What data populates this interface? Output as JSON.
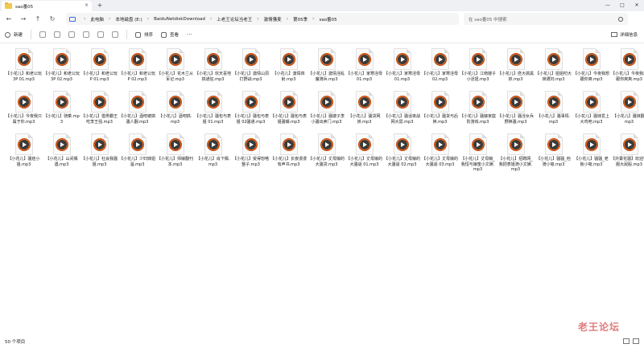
{
  "window": {
    "tab_title": "sao番05",
    "tab_close": "×",
    "new_tab": "+",
    "controls": [
      "—",
      "□",
      "✕"
    ]
  },
  "nav": {
    "back": "←",
    "forward": "→",
    "up": "↑",
    "refresh": "↻"
  },
  "breadcrumbs": [
    "此电脑",
    "本地磁盘 (E:)",
    "BaiduNetdiskDownload",
    "上老王论坛当老王",
    "激情骚麦",
    "第05季",
    "sao番05"
  ],
  "breadcrumb_sep": "›",
  "search": {
    "placeholder": "在 sao番05 中搜索"
  },
  "toolbar": {
    "new_label": "新建",
    "sort_label": "排序",
    "view_label": "查看",
    "more": "···",
    "details_label": "详细信息"
  },
  "files": [
    "【小花儿】和老公玩3P 01.mp3",
    "【小花儿】和老公玩3P 02.mp3",
    "【小花儿】和老公玩P 01.mp3",
    "【小花儿】和老公玩P 02.mp3",
    "【小花儿】花木兰从军记.mp3",
    "【小花儿】欢天喜地搞通狂.mp3",
    "【小花儿】激情山洞打野战.mp3",
    "【小花儿】激情四射.mp3",
    "【小花儿】激情淫乱魔骑兵.mp3",
    "【小花儿】家寒淫母 01.mp3",
    "【小花儿】家寒淫母 01.mp3",
    "【小花儿】家寒淫母 02.mp3",
    "【小花儿】江南嫂子小淫妞.mp3",
    "【小花儿】痉大搞黑妖.mp3",
    "【小花儿】姐姐叨大妹遭妇.mp3",
    "【小花儿】今夜我想跟你爽.mp3",
    "【小花儿】今夜我想跟你爽爽.mp3",
    "【小花儿】今夜我只属于你.mp3",
    "【小花儿】骑乘.mp3",
    "【小花儿】猎男霸王吃李王强.mp3",
    "【小花儿】酒吧被搞骚人翻.mp3",
    "【小花儿】酒吧搞.mp3",
    "【小花儿】骚包与表姐 01.mp3",
    "【小花儿】骚包与表姐 02骚通.mp3",
    "【小花儿】骚包与表姐骚嘴.mp3",
    "【小花儿】骚嫂子李小骚出卖门.mp3",
    "【小花儿】骚货网娇.mp3",
    "【小花儿】骚话夜战网大屌.mp3",
    "【小花儿】骚货与后换.mp3",
    "【小花儿】骚娘家庭阶游戏.mp3",
    "【小花儿】骚淫女兵野换骚.mp3",
    "【小花儿】骚事情.mp3",
    "【小花儿】骚妹爱上大鸡吧.mp3",
    "【小花儿】骚妹翻.mp3",
    "【小花儿】骚娃小姐.mp3",
    "【小花儿】山间偶遇.mp3",
    "【小花儿】社会我骚姐.mp3",
    "【小花儿】少妇妹姐温.mp3",
    "【小花儿】师娘翻刊本.mp3",
    "【小花儿】肖下偶.mp3",
    "【小花儿】受得恕嗒整子.mp3",
    "【小花儿】长夜漫漫有声书.mp3",
    "【小花儿】丈母娘的大骚货.mp3",
    "【小花儿】丈母娘的大骚逼 01.mp3",
    "【小花儿】丈母娘的大骚逼 02.mp3",
    "【小花儿】丈母娘的大骚逼 03.mp3",
    "【小花儿】丈母娘_我恒与娘蜜小文娱.mp3",
    "【小花儿】招聘网_我把表姐骑小文娱.mp3",
    "【小花儿】骚骚_他骑小吸.mp3",
    "【小花儿】骚骚_老板小吸.mp3",
    "【外賣花骚】欢迎客服大屁股.mp3"
  ],
  "status": {
    "count": "50 个项目"
  },
  "watermark": "老王论坛"
}
